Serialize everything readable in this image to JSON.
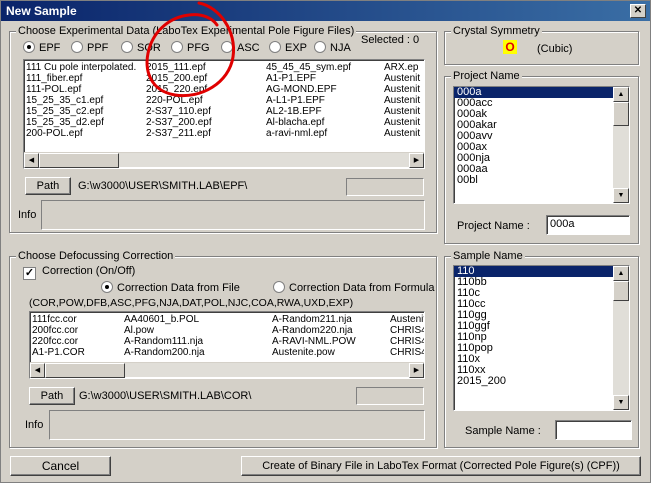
{
  "window": {
    "title": "New Sample",
    "close_glyph": "✕"
  },
  "experimental": {
    "group_label": "Choose Experimental Data (LaboTex Experimental Pole Figure Files)",
    "selected_text": "Selected : 0",
    "formats": [
      "EPF",
      "PPF",
      "SOR",
      "PFG",
      "ASC",
      "EXP",
      "NJA"
    ],
    "selected_format": "EPF",
    "files": [
      [
        "111 Cu pole interpolated.",
        "2015_111.epf",
        "45_45_45_sym.epf",
        "ARX.ep"
      ],
      [
        "111_fiber.epf",
        "2015_200.epf",
        "A1-P1.EPF",
        "Austenit"
      ],
      [
        "111-POL.epf",
        "2015_220.epf",
        "AG-MOND.EPF",
        "Austenit"
      ],
      [
        "15_25_35_c1.epf",
        "220-POL.epf",
        "A-L1-P1.EPF",
        "Austenit"
      ],
      [
        "15_25_35_c2.epf",
        "2-S37_110.epf",
        "AL2-1B.EPF",
        "Austenit"
      ],
      [
        "15_25_35_d2.epf",
        "2-S37_200.epf",
        "Al-blacha.epf",
        "Austenit"
      ],
      [
        "200-POL.epf",
        "2-S37_211.epf",
        "a-ravi-nml.epf",
        "Austenit"
      ]
    ],
    "path_button": "Path",
    "path_value": "G:\\w3000\\USER\\SMITH.LAB\\EPF\\",
    "info_label": "Info"
  },
  "defocus": {
    "group_label": "Choose Defocussing Correction",
    "correction_label": "Correction (On/Off)",
    "correction_checked": true,
    "from_file_label": "Correction Data from File",
    "from_formula_label": "Correction Data from Formula",
    "from_file_selected": true,
    "extensions_text": "(COR,POW,DFB,ASC,PFG,NJA,DAT,POL,NJC,COA,RWA,UXD,EXP)",
    "files": [
      [
        "111fcc.cor",
        "AA40601_b.POL",
        "A-Random211.nja",
        "Austenit"
      ],
      [
        "200fcc.cor",
        "Al.pow",
        "A-Random220.nja",
        "CHRIS4"
      ],
      [
        "220fcc.cor",
        "A-Random111.nja",
        "A-RAVI-NML.POW",
        "CHRIS4"
      ],
      [
        "A1-P1.COR",
        "A-Random200.nja",
        "Austenite.pow",
        "CHRIS4"
      ]
    ],
    "path_button": "Path",
    "path_value": "G:\\w3000\\USER\\SMITH.LAB\\COR\\",
    "info_label": "Info"
  },
  "crystal": {
    "group_label": "Crystal Symmetry",
    "symbol": "O",
    "symmetry": "(Cubic)"
  },
  "project": {
    "group_label": "Project Name",
    "items": [
      "000a",
      "000acc",
      "000ak",
      "000akar",
      "000avv",
      "000ax",
      "000nja",
      "000aa",
      "00bl"
    ],
    "selected": "000a",
    "name_label": "Project Name :",
    "name_value": "000a"
  },
  "sample": {
    "group_label": "Sample Name",
    "items": [
      "110",
      "110bb",
      "110c",
      "110cc",
      "110gg",
      "110ggf",
      "110np",
      "110pop",
      "110x",
      "110xx",
      "2015_200"
    ],
    "selected": "110",
    "name_label": "Sample Name :",
    "name_value": ""
  },
  "buttons": {
    "cancel": "Cancel",
    "create": "Create of Binary File in LaboTex Format (Corrected Pole Figure(s) (CPF))"
  },
  "colors": {
    "titlebar": "#0a246a",
    "selection": "#0a246a",
    "annotation": "#e00000",
    "symmetry_bg": "#ffff00"
  }
}
